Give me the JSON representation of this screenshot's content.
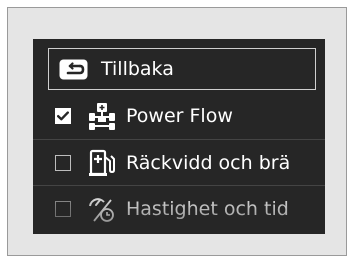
{
  "menu": {
    "back_label": "Tillbaka",
    "items": [
      {
        "label": "Power Flow",
        "checked": true,
        "icon": "power-flow-icon"
      },
      {
        "label": "Räckvidd och brä",
        "checked": false,
        "icon": "fuel-pump-icon"
      },
      {
        "label": "Hastighet och tid",
        "checked": false,
        "icon": "speed-time-icon"
      }
    ]
  }
}
